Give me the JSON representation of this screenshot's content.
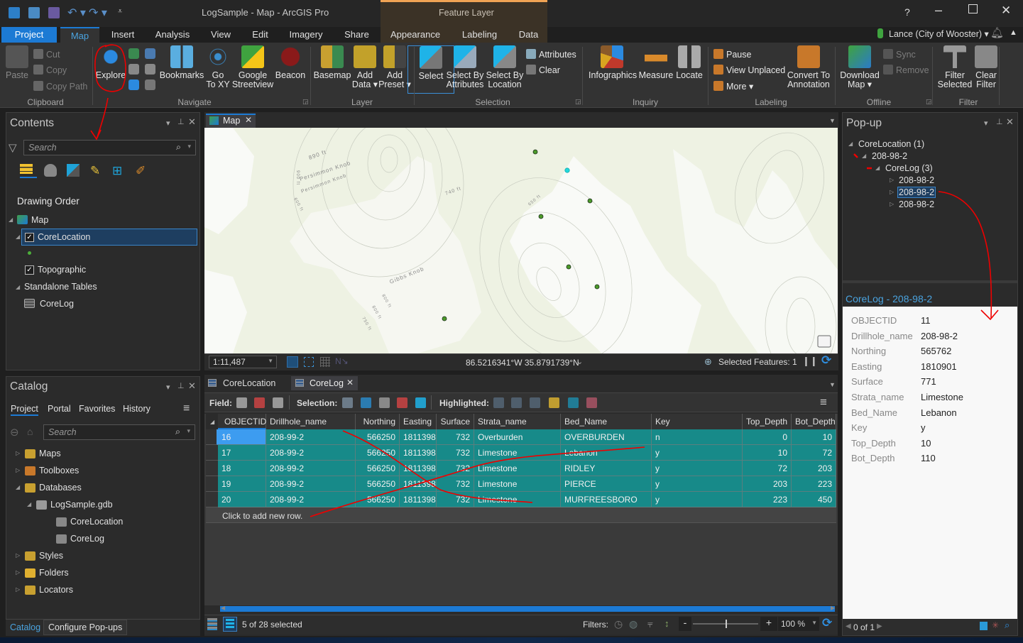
{
  "window": {
    "title": "LogSample - Map - ArcGIS Pro",
    "contextual_tab_group": "Feature Layer",
    "help": "?",
    "user": "Lance (City of Wooster)",
    "accent": "#1c7ad4"
  },
  "ribbon_tabs": [
    "Project",
    "Map",
    "Insert",
    "Analysis",
    "View",
    "Edit",
    "Imagery",
    "Share",
    "Appearance",
    "Labeling",
    "Data"
  ],
  "active_tab": "Map",
  "ribbon": {
    "groups": [
      "Clipboard",
      "Navigate",
      "Layer",
      "Selection",
      "Inquiry",
      "Labeling",
      "Offline",
      "Filter"
    ],
    "large_buttons": [
      {
        "label": "Paste",
        "icon": "clipboard-icon",
        "disabled": true
      },
      {
        "label": "Explore",
        "icon": "explore-icon"
      },
      {
        "label": "Bookmarks",
        "icon": "bookmarks-icon"
      },
      {
        "label": "Go\nTo XY",
        "icon": "crosshair-icon"
      },
      {
        "label": "Google\nStreetview",
        "icon": "streetview-icon"
      },
      {
        "label": "Beacon",
        "icon": "beacon-icon"
      },
      {
        "label": "Basemap",
        "icon": "basemap-icon"
      },
      {
        "label": "Add\nData ▾",
        "icon": "add-data-icon"
      },
      {
        "label": "Add\nPreset ▾",
        "icon": "add-preset-icon"
      },
      {
        "label": "Select",
        "icon": "select-icon",
        "active": true
      },
      {
        "label": "Select By\nAttributes",
        "icon": "select-by-attributes-icon"
      },
      {
        "label": "Select By\nLocation",
        "icon": "select-by-location-icon"
      },
      {
        "label": "Infographics",
        "icon": "infographics-icon"
      },
      {
        "label": "Measure",
        "icon": "measure-icon"
      },
      {
        "label": "Locate",
        "icon": "binoculars-icon"
      },
      {
        "label": "Convert To\nAnnotation",
        "icon": "convert-annotation-icon"
      },
      {
        "label": "Download\nMap ▾",
        "icon": "download-map-icon"
      },
      {
        "label": "Filter\nSelected",
        "icon": "filter-icon"
      },
      {
        "label": "Clear\nFilter",
        "icon": "clear-filter-icon"
      }
    ],
    "small_buttons": [
      {
        "label": "Cut",
        "icon": "scissors-icon",
        "disabled": true
      },
      {
        "label": "Copy",
        "icon": "copy-icon",
        "disabled": true
      },
      {
        "label": "Copy Path",
        "icon": "copy-path-icon",
        "disabled": true
      },
      {
        "label": "Attributes",
        "icon": "attributes-table-icon"
      },
      {
        "label": "Clear",
        "icon": "clear-selection-icon"
      },
      {
        "label": "Pause",
        "icon": "pause-label-icon"
      },
      {
        "label": "View Unplaced",
        "icon": "view-unplaced-icon"
      },
      {
        "label": "More ▾",
        "icon": "more-label-icon"
      },
      {
        "label": "Sync",
        "icon": "sync-icon",
        "disabled": true
      },
      {
        "label": "Remove",
        "icon": "remove-icon",
        "disabled": true
      }
    ]
  },
  "contents": {
    "title": "Contents",
    "search_placeholder": "Search",
    "heading": "Drawing Order",
    "items": [
      "Map",
      "CoreLocation",
      "Topographic",
      "Standalone Tables",
      "CoreLog"
    ]
  },
  "catalog": {
    "title": "Catalog",
    "tabs": [
      "Project",
      "Portal",
      "Favorites",
      "History"
    ],
    "search_placeholder": "Search",
    "items": [
      "Maps",
      "Toolboxes",
      "Databases",
      "LogSample.gdb",
      "CoreLocation",
      "CoreLog",
      "Styles",
      "Folders",
      "Locators"
    ],
    "bottom_tabs": [
      "Catalog",
      "Configure Pop-ups"
    ]
  },
  "map": {
    "tab": "Map",
    "scale": "1:11,487",
    "coordinates": "86.5216341°W 35.8791739°N",
    "selected_features": "Selected Features: 1",
    "labels": [
      "890 ft",
      "Persimmon Knob",
      "Persimmon Knob",
      "900 ft",
      "600 ft",
      "740 ft",
      "650 ft",
      "Gibbs Knob",
      "800 ft",
      "800 ft",
      "750 ft"
    ]
  },
  "table": {
    "tabs": [
      "CoreLocation",
      "CoreLog"
    ],
    "active_tab": "CoreLog",
    "toolbar": {
      "field": "Field:",
      "selection": "Selection:",
      "highlighted": "Highlighted:"
    },
    "columns": [
      "OBJECTID",
      "Drillhole_name",
      "Northing",
      "Easting",
      "Surface",
      "Strata_name",
      "Bed_Name",
      "Key",
      "Top_Depth",
      "Bot_Depth"
    ],
    "rows": [
      [
        "16",
        "208-99-2",
        "566250",
        "1811398",
        "732",
        "Overburden",
        "OVERBURDEN",
        "n",
        "0",
        "10"
      ],
      [
        "17",
        "208-99-2",
        "566250",
        "1811398",
        "732",
        "Limestone",
        "Lebanon",
        "y",
        "10",
        "72"
      ],
      [
        "18",
        "208-99-2",
        "566250",
        "1811398",
        "732",
        "Limestone",
        "RIDLEY",
        "y",
        "72",
        "203"
      ],
      [
        "19",
        "208-99-2",
        "566250",
        "1811398",
        "732",
        "Limestone",
        "PIERCE",
        "y",
        "203",
        "223"
      ],
      [
        "20",
        "208-99-2",
        "566250",
        "1811398",
        "732",
        "Limestone",
        "MURFREESBORO",
        "y",
        "223",
        "450"
      ]
    ],
    "add_row": "Click to add new row.",
    "selected_status": "5 of 28 selected",
    "filters_label": "Filters:",
    "zoom": "100 %",
    "selection_color": "#178a89"
  },
  "popup": {
    "title": "Pop-up",
    "tree": {
      "layer": "CoreLocation  (1)",
      "feature": "208-98-2",
      "related": "CoreLog  (3)",
      "records": [
        "208-98-2",
        "208-98-2",
        "208-98-2"
      ]
    },
    "record_title": "CoreLog - 208-98-2",
    "fields": [
      [
        "OBJECTID",
        "11"
      ],
      [
        "Drillhole_name",
        "208-98-2"
      ],
      [
        "Northing",
        "565762"
      ],
      [
        "Easting",
        "1810901"
      ],
      [
        "Surface",
        "771"
      ],
      [
        "Strata_name",
        "Limestone"
      ],
      [
        "Bed_Name",
        "Lebanon"
      ],
      [
        "Key",
        "y"
      ],
      [
        "Top_Depth",
        "10"
      ],
      [
        "Bot_Depth",
        "110"
      ]
    ],
    "nav": "0 of 1"
  }
}
